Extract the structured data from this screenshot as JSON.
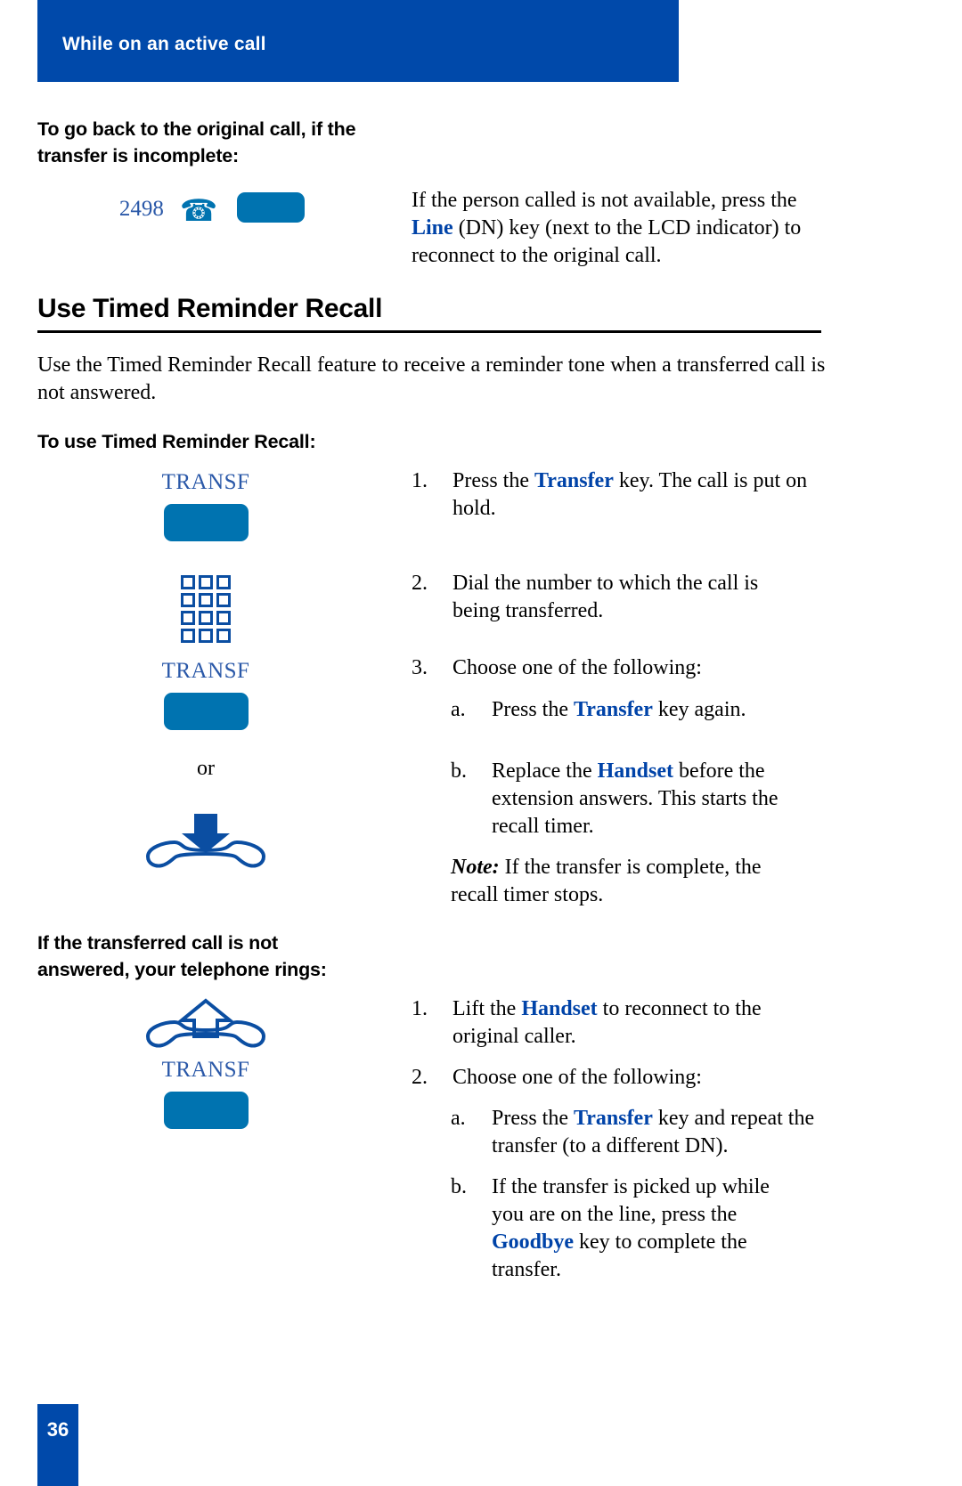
{
  "header": {
    "title": "While on an active call"
  },
  "colors": {
    "banner_blue": "#0049aa",
    "key_blue": "#0073b0",
    "link_blue": "#0043a8",
    "label_blue": "#2a58a8",
    "keypad_blue": "#0b4ea2"
  },
  "section_a": {
    "heading_line1": "To go back to the original call, if the",
    "heading_line2": "transfer is incomplete:",
    "dn_number": "2498",
    "phone_icon": "desk-phone-icon",
    "line_key_icon": "blue-line-key",
    "body": {
      "part1": "If the person called is not available, press the ",
      "keyword": "Line",
      "part2": " (DN) key (next to the LCD indicator) to reconnect to the original call."
    }
  },
  "section_b": {
    "title": "Use Timed Reminder Recall",
    "intro": "Use the Timed Reminder Recall feature to receive a reminder tone when a transferred call is not answered.",
    "sub_heading": "To use Timed Reminder Recall:",
    "icons": {
      "transf_label_1": "TRANSF",
      "transf_key_1": "blue-transfer-key",
      "keypad": "dial-keypad-icon",
      "transf_label_2": "TRANSF",
      "transf_key_2": "blue-transfer-key",
      "or": "or",
      "handset_down": "handset-replace-down-icon"
    },
    "steps": [
      {
        "marker": "1.",
        "part1": "Press the ",
        "keyword": "Transfer",
        "part2": " key. The call is put on hold."
      },
      {
        "marker": "2.",
        "part1": "Dial the number to which the call is being transferred.",
        "keyword": "",
        "part2": ""
      },
      {
        "marker": "3.",
        "part1": "Choose one of the following:",
        "keyword": "",
        "part2": ""
      }
    ],
    "substeps": [
      {
        "marker": "a.",
        "part1": "Press the ",
        "keyword": "Transfer",
        "part2": " key again."
      },
      {
        "marker": "b.",
        "part1": "Replace the ",
        "keyword": "Handset",
        "part2": " before the extension answers. This starts the recall timer."
      }
    ],
    "note": {
      "lead": "Note:",
      "text": " If the transfer is complete, the recall timer stops."
    }
  },
  "section_c": {
    "heading_line1": "If the transferred call is not",
    "heading_line2": "answered, your telephone rings:",
    "icons": {
      "handset_up": "handset-lift-up-icon",
      "transf_label": "TRANSF",
      "transf_key": "blue-transfer-key"
    },
    "steps": [
      {
        "marker": "1.",
        "part1": "Lift the ",
        "keyword": "Handset",
        "part2": " to reconnect to the original caller."
      },
      {
        "marker": "2.",
        "part1": "Choose one of the following:",
        "keyword": "",
        "part2": ""
      }
    ],
    "substeps": [
      {
        "marker": "a.",
        "part1": "Press the ",
        "keyword": "Transfer",
        "part2": " key and repeat the transfer (to a different DN)."
      },
      {
        "marker": "b.",
        "part1": "If the transfer is picked up while you are on the line, press the ",
        "keyword": "Goodbye",
        "part2": " key to complete the transfer."
      }
    ]
  },
  "footer": {
    "page_number": "36"
  }
}
